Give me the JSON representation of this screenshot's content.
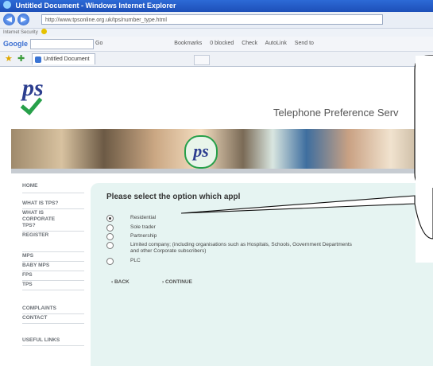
{
  "browser": {
    "window_title": "Untitled Document - Windows Internet Explorer",
    "url": "http://www.tpsonline.org.uk/tps/number_type.html",
    "security_text": "Internet Security",
    "google_label": "Google",
    "toolbar_items": [
      "Go",
      "Bookmarks",
      "0 blocked",
      "Check",
      "AutoLink",
      "Send to"
    ],
    "tab_title": "Untitled Document"
  },
  "site": {
    "title": "Telephone Preference Serv",
    "logo_text": "ps",
    "badge_text": "ps"
  },
  "sidebar": {
    "items": [
      {
        "label": "HOME"
      },
      {
        "label": "WHAT IS TPS?"
      },
      {
        "label": "WHAT IS CORPORATE TPS?"
      },
      {
        "label": "REGISTER"
      },
      {
        "label": "MPS"
      },
      {
        "label": "BABY MPS"
      },
      {
        "label": "FPS"
      },
      {
        "label": "TPS"
      },
      {
        "label": "COMPLAINTS"
      },
      {
        "label": "CONTACT"
      },
      {
        "label": "USEFUL LINKS"
      }
    ]
  },
  "form": {
    "prompt": "Please select the option which appl",
    "options": [
      {
        "label": "Residential",
        "selected": true
      },
      {
        "label": "Sole trader",
        "selected": false
      },
      {
        "label": "Partnership",
        "selected": false
      },
      {
        "label": "Limited company; (including organisations such as Hospitals, Schools, Government Departments and other Corporate subscribers)",
        "selected": false
      },
      {
        "label": "PLC",
        "selected": false
      }
    ],
    "back_label": "‹ BACK",
    "continue_label": "› CONTINUE"
  }
}
